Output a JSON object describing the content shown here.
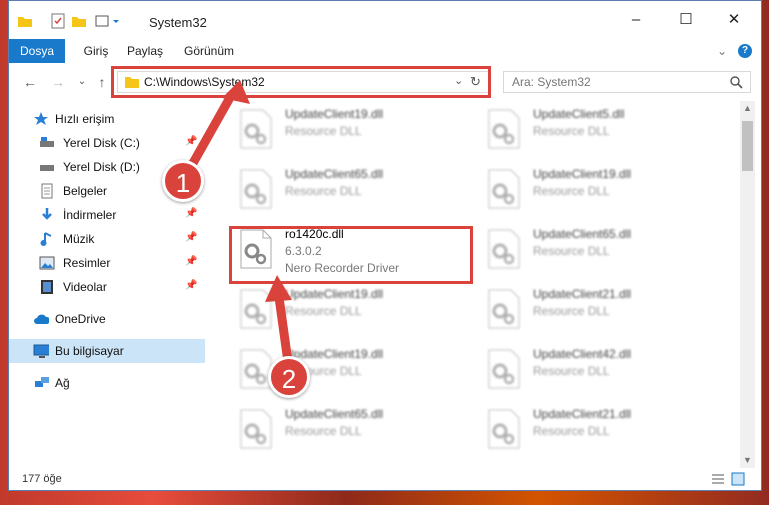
{
  "window": {
    "title": "System32"
  },
  "ribbon": {
    "tabs": [
      "Dosya",
      "Giriş",
      "Paylaş",
      "Görünüm"
    ]
  },
  "address": {
    "path": "C:\\Windows\\System32"
  },
  "search": {
    "placeholder": "Ara: System32"
  },
  "sidebar": {
    "items": [
      {
        "label": "Hızlı erişim",
        "icon": "star-icon"
      },
      {
        "label": "Yerel Disk (C:)",
        "icon": "drive-icon"
      },
      {
        "label": "Yerel Disk (D:)",
        "icon": "drive-icon"
      },
      {
        "label": "Belgeler",
        "icon": "documents-icon"
      },
      {
        "label": "İndirmeler",
        "icon": "download-icon"
      },
      {
        "label": "Müzik",
        "icon": "music-icon"
      },
      {
        "label": "Resimler",
        "icon": "pictures-icon"
      },
      {
        "label": "Videolar",
        "icon": "videos-icon"
      },
      {
        "label": "OneDrive",
        "icon": "cloud-icon"
      },
      {
        "label": "Bu bilgisayar",
        "icon": "computer-icon"
      },
      {
        "label": "Ağ",
        "icon": "network-icon"
      }
    ]
  },
  "files": {
    "left": [
      {
        "name": "UpdateClient19.dll",
        "type": "Resource DLL"
      },
      {
        "name": "UpdateClient65.dll",
        "type": "Resource DLL"
      },
      {
        "name": "ro1420c.dll",
        "version": "6.3.0.2",
        "description": "Nero Recorder Driver"
      },
      {
        "name": "UpdateClient19.dll",
        "type": "Resource DLL"
      },
      {
        "name": "UpdateClient19.dll",
        "type": "Resource DLL"
      },
      {
        "name": "UpdateClient65.dll",
        "type": "Resource DLL"
      }
    ],
    "right": [
      {
        "name": "UpdateClient5.dll",
        "type": "Resource DLL"
      },
      {
        "name": "UpdateClient19.dll",
        "type": "Resource DLL"
      },
      {
        "name": "UpdateClient65.dll",
        "type": "Resource DLL"
      },
      {
        "name": "UpdateClient21.dll",
        "type": "Resource DLL"
      },
      {
        "name": "UpdateClient42.dll",
        "type": "Resource DLL"
      },
      {
        "name": "UpdateClient21.dll",
        "type": "Resource DLL"
      }
    ]
  },
  "status": {
    "count": "177 öğe"
  },
  "callouts": [
    "1",
    "2"
  ],
  "colors": {
    "accent": "#1979ca",
    "highlight": "#d9433b",
    "selected": "#cce4f7"
  }
}
